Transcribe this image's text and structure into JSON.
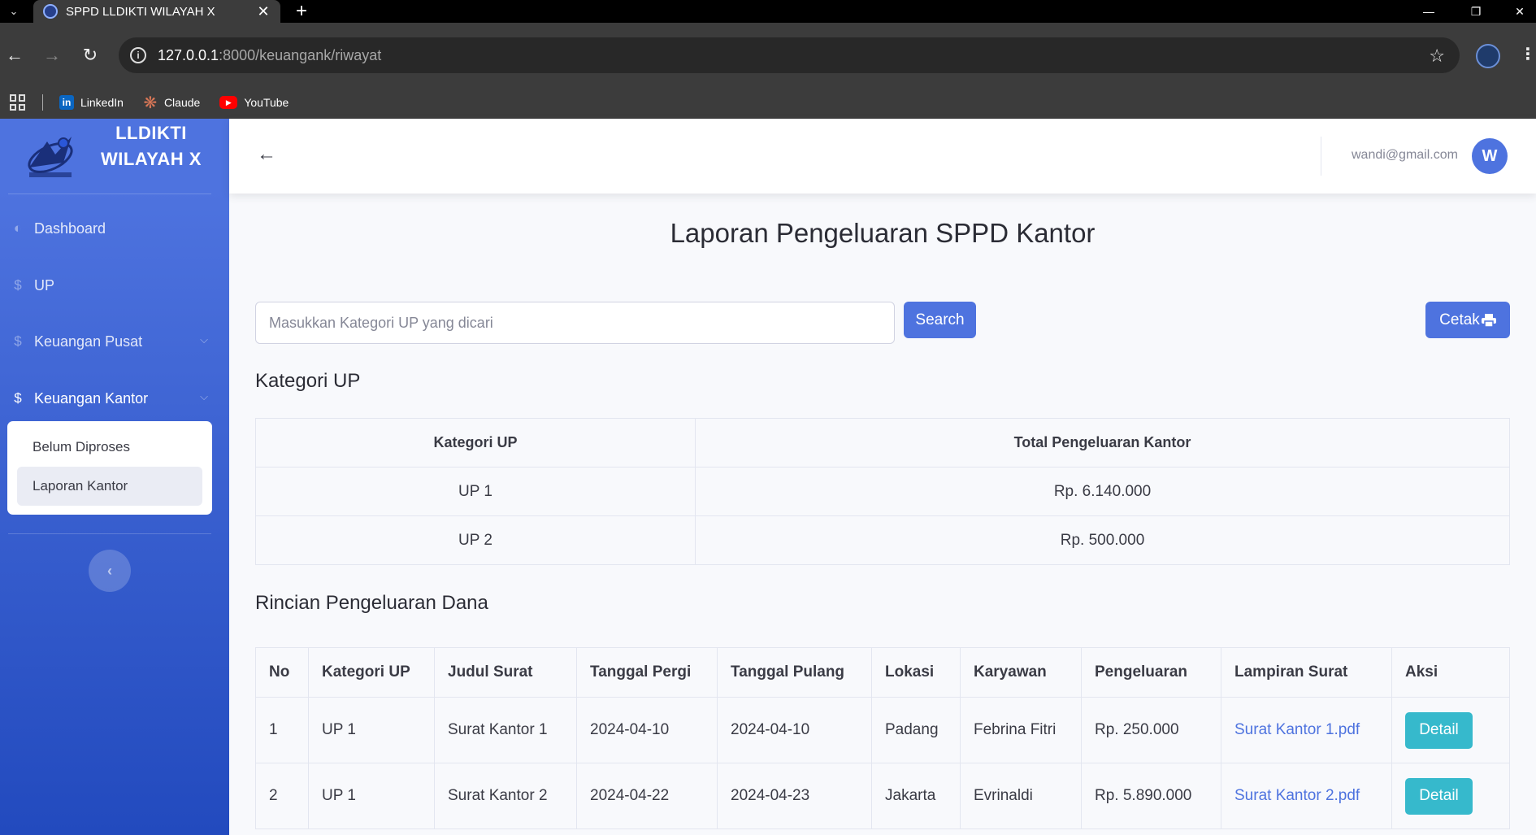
{
  "browser": {
    "tab_title": "SPPD LLDIKTI WILAYAH X",
    "url_host": "127.0.0.1",
    "url_path": ":8000/keuangank/riwayat",
    "bookmarks": [
      {
        "label": "LinkedIn",
        "icon": "linkedin-icon"
      },
      {
        "label": "Claude",
        "icon": "claude-icon"
      },
      {
        "label": "YouTube",
        "icon": "youtube-icon"
      }
    ]
  },
  "sidebar": {
    "brand": "LLDIKTI WILAYAH X",
    "items": [
      {
        "label": "Dashboard",
        "icon": "tachometer-icon"
      },
      {
        "label": "UP",
        "icon": "dollar-icon"
      },
      {
        "label": "Keuangan Pusat",
        "icon": "dollar-icon"
      },
      {
        "label": "Keuangan Kantor",
        "icon": "dollar-icon"
      }
    ],
    "submenu": [
      "Belum Diproses",
      "Laporan Kantor"
    ]
  },
  "topbar": {
    "email": "wandi@gmail.com",
    "avatar_letter": "W"
  },
  "main": {
    "title": "Laporan Pengeluaran SPPD Kantor",
    "search_placeholder": "Masukkan Kategori UP yang dicari",
    "search_button": "Search",
    "print_button": "Cetak",
    "kategori_heading": "Kategori UP",
    "kategori_table": {
      "headers": [
        "Kategori UP",
        "Total Pengeluaran Kantor"
      ],
      "rows": [
        [
          "UP 1",
          "Rp. 6.140.000"
        ],
        [
          "UP 2",
          "Rp. 500.000"
        ]
      ]
    },
    "rincian_heading": "Rincian Pengeluaran Dana",
    "rincian_table": {
      "headers": [
        "No",
        "Kategori UP",
        "Judul Surat",
        "Tanggal Pergi",
        "Tanggal Pulang",
        "Lokasi",
        "Karyawan",
        "Pengeluaran",
        "Lampiran Surat",
        "Aksi"
      ],
      "rows": [
        [
          "1",
          "UP 1",
          "Surat Kantor 1",
          "2024-04-10",
          "2024-04-10",
          "Padang",
          "Febrina Fitri",
          "Rp. 250.000",
          "Surat Kantor 1.pdf",
          "Detail"
        ],
        [
          "2",
          "UP 1",
          "Surat Kantor 2",
          "2024-04-22",
          "2024-04-23",
          "Jakarta",
          "Evrinaldi",
          "Rp. 5.890.000",
          "Surat Kantor 2.pdf",
          "Detail"
        ]
      ]
    }
  },
  "colors": {
    "primary": "#4e73df",
    "info": "#36b9cc",
    "sidebar_gradient_end": "#224abe"
  }
}
